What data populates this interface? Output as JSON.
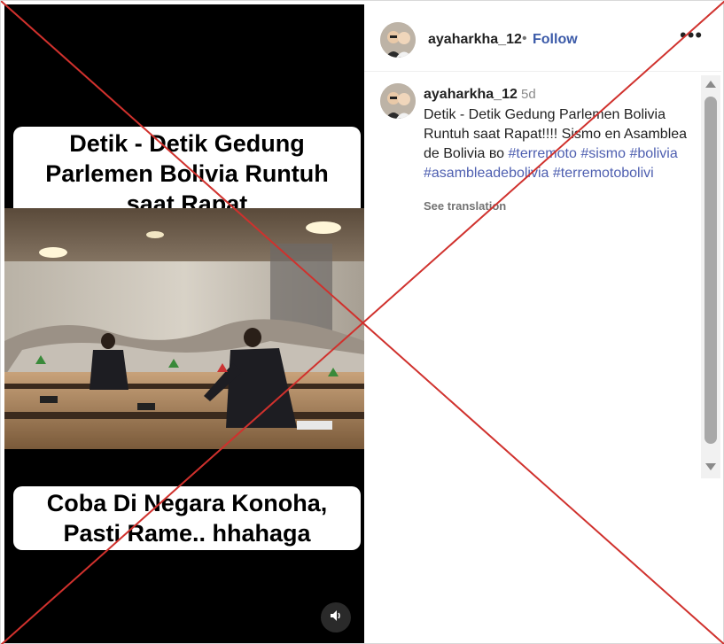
{
  "media": {
    "caption_top": "Detik - Detik Gedung Parlemen Bolivia Runtuh saat Rapat",
    "caption_bottom": "Coba Di Negara Konoha, Pasti Rame.. hhahaga",
    "sound_icon": "speaker-icon"
  },
  "header": {
    "username": "ayaharkha_12",
    "separator": "•",
    "follow_label": "Follow",
    "more_label": "•••"
  },
  "comment": {
    "username": "ayaharkha_12",
    "time": "5d",
    "text_plain": "Detik - Detik Gedung Parlemen Bolivia Runtuh saat Rapat!!!! Sismo en Asamblea de Bolivia во ",
    "hashtags": [
      "#terremoto",
      "#sismo",
      "#bolivia",
      "#asambleadebolivia",
      "#terremotobolivi"
    ],
    "see_translation": "See translation"
  },
  "colors": {
    "follow": "#3b5aa8",
    "hashtag": "#4e5fb0",
    "overlay_x": "#d0312d"
  }
}
